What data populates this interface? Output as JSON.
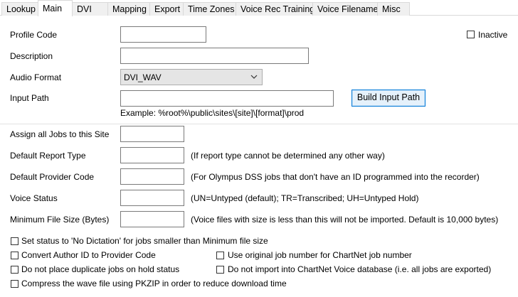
{
  "tabs": [
    {
      "label": "Lookup"
    },
    {
      "label": "Main"
    },
    {
      "label": "DVI"
    },
    {
      "label": "Mapping"
    },
    {
      "label": "Export"
    },
    {
      "label": "Time Zones"
    },
    {
      "label": "Voice Rec Training"
    },
    {
      "label": "Voice Filename"
    },
    {
      "label": "Misc"
    }
  ],
  "active_tab": "Main",
  "form": {
    "profile_code_label": "Profile Code",
    "profile_code_value": "",
    "inactive_label": "Inactive",
    "inactive_checked": false,
    "description_label": "Description",
    "description_value": "",
    "audio_format_label": "Audio Format",
    "audio_format_value": "DVI_WAV",
    "input_path_label": "Input Path",
    "input_path_value": "",
    "build_input_path_label": "Build Input Path",
    "example_text": "Example:  %root%\\public\\sites\\[site]\\[format]\\prod",
    "assign_site_label": "Assign all Jobs to this Site",
    "assign_site_value": "",
    "default_report_type_label": "Default Report Type",
    "default_report_type_value": "",
    "default_report_type_hint": "(If report type cannot be determined any other way)",
    "default_provider_code_label": "Default Provider Code",
    "default_provider_code_value": "",
    "default_provider_code_hint": "(For Olympus DSS jobs that don't have an ID programmed into the recorder)",
    "voice_status_label": "Voice Status",
    "voice_status_value": "",
    "voice_status_hint": "(UN=Untyped (default);  TR=Transcribed;  UH=Untyped Hold)",
    "min_file_size_label": "Minimum File Size (Bytes)",
    "min_file_size_value": "",
    "min_file_size_hint": "(Voice files with size is less than this will not be imported. Default is 10,000 bytes)"
  },
  "options": {
    "no_dictation_label": "Set status to 'No Dictation' for jobs smaller than Minimum file size",
    "convert_author_label": "Convert Author ID to Provider Code",
    "use_original_job_label": "Use original job number for ChartNet job number",
    "no_duplicate_hold_label": "Do not place duplicate jobs on hold status",
    "no_import_voice_db_label": "Do not import into ChartNet Voice database (i.e. all jobs are exported)",
    "compress_pkzip_label": "Compress the wave file using PKZIP in order to reduce download time"
  },
  "colors": {
    "button_border": "#0078d7",
    "button_fill": "#e5f1fb",
    "tab_inactive": "#f0f0f0"
  }
}
